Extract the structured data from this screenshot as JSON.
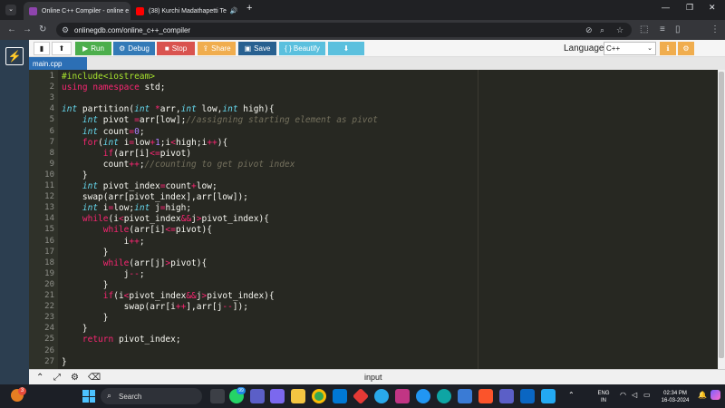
{
  "browser": {
    "tabs": [
      {
        "title": "Online C++ Compiler - online e",
        "icon_color": "#8e44ad"
      },
      {
        "title": "(38) Kurchi Madathapetti Te",
        "icon_color": "#ff0000"
      }
    ],
    "url": "onlinegdb.com/online_c++_compiler",
    "new_tab_label": "+"
  },
  "toolbar": {
    "run_label": "Run",
    "debug_label": "Debug",
    "stop_label": "Stop",
    "share_label": "Share",
    "save_label": "Save",
    "beautify_label": "{ } Beautify",
    "language_label": "Language",
    "language_value": "C++"
  },
  "colors": {
    "run": "#4cae4c",
    "debug": "#337ab7",
    "stop": "#d9534f",
    "share": "#f0ad4e",
    "save": "#286090",
    "beautify": "#5bc0de",
    "download": "#5bc0de"
  },
  "file_tab": "main.cpp",
  "code_lines": [
    {
      "n": "1",
      "html": "<span class=\"pp\">#include&lt;iostream&gt;</span>"
    },
    {
      "n": "2",
      "html": "<span class=\"kw\">using</span> <span class=\"kw\">namespace</span> std;"
    },
    {
      "n": "3",
      "html": ""
    },
    {
      "n": "4",
      "html": "<span class=\"ty\">int</span> partition(<span class=\"ty\">int</span> <span class=\"op\">*</span>arr,<span class=\"ty\">int</span> low,<span class=\"ty\">int</span> high){"
    },
    {
      "n": "5",
      "html": "    <span class=\"ty\">int</span> pivot <span class=\"op\">=</span>arr[low];<span class=\"cm\">//assigning starting element as pivot</span>"
    },
    {
      "n": "6",
      "html": "    <span class=\"ty\">int</span> count<span class=\"op\">=</span><span class=\"num\">0</span>;"
    },
    {
      "n": "7",
      "html": "    <span class=\"kw\">for</span>(<span class=\"ty\">int</span> i<span class=\"op\">=</span>low<span class=\"op\">+</span><span class=\"num\">1</span>;i<span class=\"op\">&lt;</span>high;i<span class=\"op\">++</span>){"
    },
    {
      "n": "8",
      "html": "        <span class=\"kw\">if</span>(arr[i]<span class=\"op\">&lt;=</span>pivot)"
    },
    {
      "n": "9",
      "html": "        count<span class=\"op\">++</span>;<span class=\"cm\">//counting to get pivot index</span>"
    },
    {
      "n": "10",
      "html": "    }"
    },
    {
      "n": "11",
      "html": "    <span class=\"ty\">int</span> pivot_index<span class=\"op\">=</span>count<span class=\"op\">+</span>low;"
    },
    {
      "n": "12",
      "html": "    swap(arr[pivot_index],arr[low]);"
    },
    {
      "n": "13",
      "html": "    <span class=\"ty\">int</span> i<span class=\"op\">=</span>low;<span class=\"ty\">int</span> j<span class=\"op\">=</span>high;"
    },
    {
      "n": "14",
      "html": "    <span class=\"kw\">while</span>(i<span class=\"op\">&lt;</span>pivot_index<span class=\"op\">&amp;&amp;</span>j<span class=\"op\">&gt;</span>pivot_index){"
    },
    {
      "n": "15",
      "html": "        <span class=\"kw\">while</span>(arr[i]<span class=\"op\">&lt;=</span>pivot){"
    },
    {
      "n": "16",
      "html": "            i<span class=\"op\">++</span>;"
    },
    {
      "n": "17",
      "html": "        }"
    },
    {
      "n": "18",
      "html": "        <span class=\"kw\">while</span>(arr[j]<span class=\"op\">&gt;</span>pivot){"
    },
    {
      "n": "19",
      "html": "            j<span class=\"op\">--</span>;"
    },
    {
      "n": "20",
      "html": "        }"
    },
    {
      "n": "21",
      "html": "        <span class=\"kw\">if</span>(i<span class=\"op\">&lt;</span>pivot_index<span class=\"op\">&amp;&amp;</span>j<span class=\"op\">&gt;</span>pivot_index){"
    },
    {
      "n": "22",
      "html": "            swap(arr[i<span class=\"op\">++</span>],arr[j<span class=\"op\">--</span>]);"
    },
    {
      "n": "23",
      "html": "        }"
    },
    {
      "n": "24",
      "html": "    }"
    },
    {
      "n": "25",
      "html": "    <span class=\"kw\">return</span> pivot_index;"
    },
    {
      "n": "26",
      "html": ""
    },
    {
      "n": "27",
      "html": "}"
    }
  ],
  "io_panel": {
    "label": "input"
  },
  "taskbar": {
    "search_placeholder": "Search",
    "lang_line1": "ENG",
    "lang_line2": "IN",
    "time": "02:34 PM",
    "date": "16-03-2024",
    "notification_count": "3",
    "widget_badge": "99"
  }
}
